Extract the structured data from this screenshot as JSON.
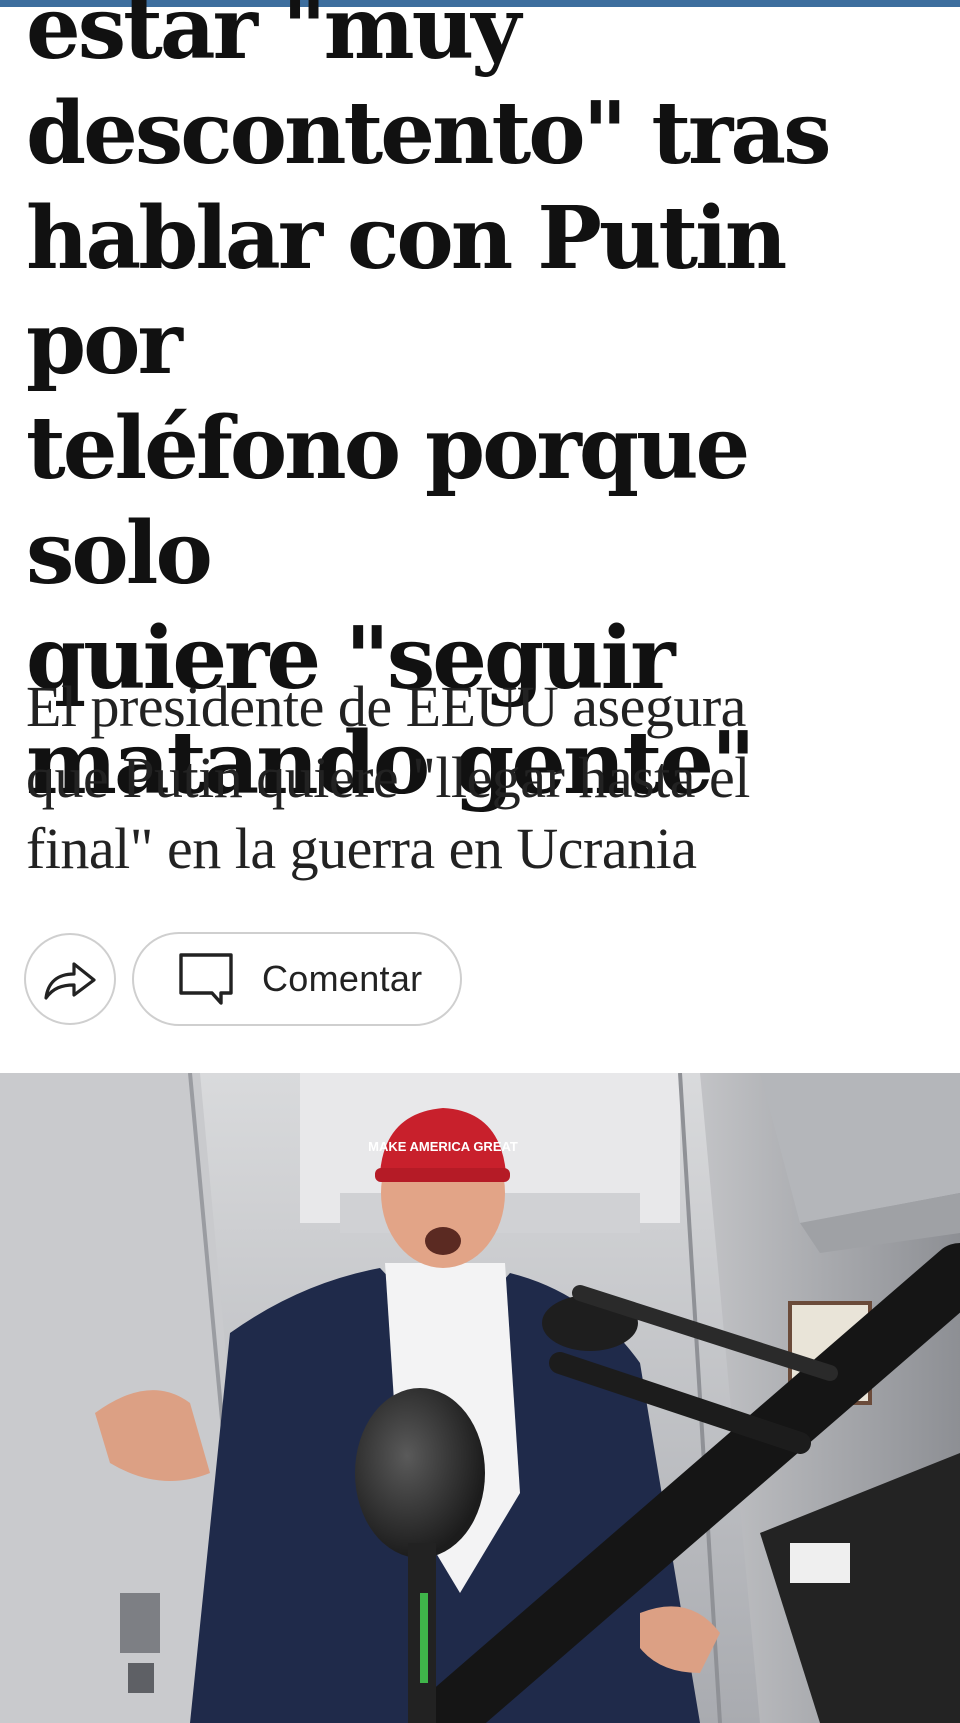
{
  "article": {
    "headline_lines": [
      "estar \"muy",
      "descontento\" tras",
      "hablar con Putin por",
      "teléfono porque solo",
      "quiere \"seguir",
      "matando gente\""
    ],
    "subtitle_lines": [
      "El presidente de EEUU asegura",
      "que Putin quiere \"llegar hasta el",
      "final\" en la guerra en Ucrania"
    ]
  },
  "actions": {
    "share_icon": "share-arrow-icon",
    "comment_icon": "speech-bubble-icon",
    "comment_label": "Comentar"
  },
  "photo": {
    "cap_text": "MAKE AMERICA GREAT"
  },
  "colors": {
    "top_bar": "#3d6e9e",
    "headline": "#111111",
    "subtitle": "#222222",
    "button_border": "#cfcfcf",
    "cap_red": "#c8202c",
    "suit_navy": "#1f2a4a"
  }
}
